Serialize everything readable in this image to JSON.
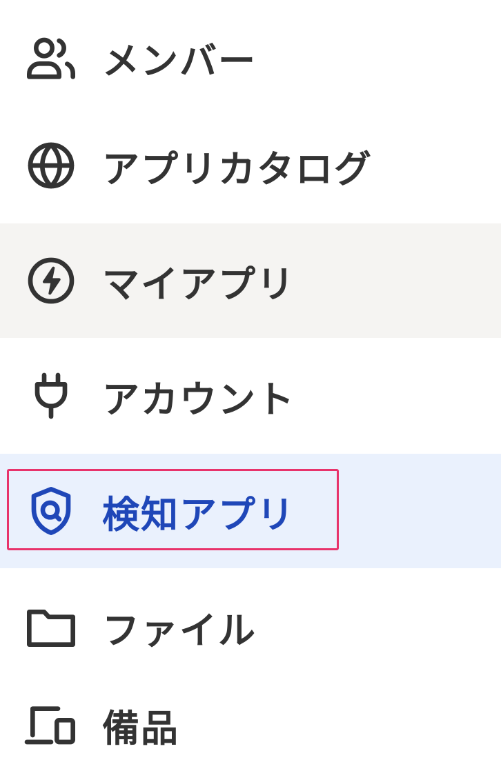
{
  "nav": {
    "items": [
      {
        "label": "メンバー",
        "icon": "members-icon",
        "state": "default"
      },
      {
        "label": "アプリカタログ",
        "icon": "globe-icon",
        "state": "default"
      },
      {
        "label": "マイアプリ",
        "icon": "lightning-icon",
        "state": "hover"
      },
      {
        "label": "アカウント",
        "icon": "plug-icon",
        "state": "default"
      },
      {
        "label": "検知アプリ",
        "icon": "shield-search-icon",
        "state": "active"
      },
      {
        "label": "ファイル",
        "icon": "folder-icon",
        "state": "default"
      },
      {
        "label": "備品",
        "icon": "devices-icon",
        "state": "default"
      }
    ]
  },
  "colors": {
    "text": "#333333",
    "active_text": "#1f47b8",
    "active_bg": "#eaf1fd",
    "hover_bg": "#f5f4f2",
    "focus_border": "#e8336b"
  }
}
